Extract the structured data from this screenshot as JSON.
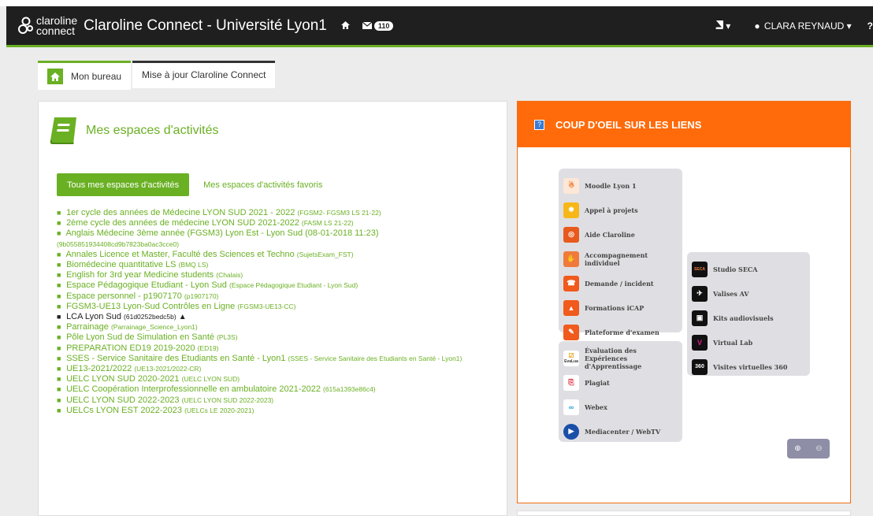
{
  "navbar": {
    "brand_line1": "claroline",
    "brand_line2": "connect",
    "title": "Claroline Connect - Université Lyon1",
    "home_icon": "home-icon",
    "mail_count": "110",
    "user_name": "CLARA REYNAUD",
    "help": "?"
  },
  "tabs": [
    {
      "label": "Mon bureau"
    },
    {
      "label": "Mise à jour Claroline Connect"
    }
  ],
  "activities": {
    "title": "Mes espaces d'activités",
    "filter_all": "Tous mes espaces d'activités",
    "filter_fav": "Mes espaces d'activités favoris",
    "items": [
      {
        "name": "1er cycle des années de Médecine LYON SUD 2021 - 2022",
        "code": "(FGSM2- FGSM3 LS 21-22)"
      },
      {
        "name": "2ème cycle des années de médecine LYON SUD 2021-2022",
        "code": "(FASM LS 21-22)"
      },
      {
        "name": "Anglais Médecine 3ème année (FGSM3) Lyon Est - Lyon Sud (08-01-2018 11:23)",
        "code": ""
      },
      {
        "name": "",
        "code": "(9b055851934408cd9b7823ba0ac3cce0)"
      },
      {
        "name": "Annales Licence et Master, Faculté des Sciences et Techno",
        "code": "(SujetsExam_FST)"
      },
      {
        "name": "Biomédecine quantitative LS",
        "code": "(BMQ LS)"
      },
      {
        "name": "English for 3rd year Medicine students",
        "code": "(Chalais)"
      },
      {
        "name": "Espace Pédagogique Etudiant - Lyon Sud",
        "code": "(Espace Pédagogique Etudiant - Lyon Sud)"
      },
      {
        "name": "Espace personnel - p1907170",
        "code": "(p1907170)"
      },
      {
        "name": "FGSM3-UE13 Lyon-Sud Contrôles en Ligne",
        "code": "(FGSM3-UE13-CC)"
      },
      {
        "name": "LCA Lyon Sud",
        "code": "(61d0252bedc5b)"
      },
      {
        "name": "Parrainage",
        "code": "(Parrainage_Science_Lyon1)"
      },
      {
        "name": "Pôle Lyon Sud de Simulation en Santé",
        "code": "(PL3S)"
      },
      {
        "name": "PREPARATION ED19 2019-2020",
        "code": "(ED19)"
      },
      {
        "name": "SSES - Service Sanitaire des Etudiants en Santé - Lyon1",
        "code": "(SSES - Service Sanitaire des Etudiants en Santé - Lyon1)"
      },
      {
        "name": "UE13-2021/2022",
        "code": "(UE13-2021/2022-CR)"
      },
      {
        "name": "UELC LYON SUD 2020-2021",
        "code": "(UELC LYON SUD)"
      },
      {
        "name": "UELC Coopération Interprofessionnelle en ambulatoire 2021-2022",
        "code": "(615a1393e86c4)"
      },
      {
        "name": "UELC LYON SUD 2022-2023",
        "code": "(UELC LYON SUD 2022-2023)"
      },
      {
        "name": "UELCs LYON EST 2022-2023",
        "code": "(UELCs LE 2020-2021)"
      }
    ]
  },
  "links": {
    "title": "COUP D'OEIL SUR LES LIENS",
    "box1": [
      "Moodle Lyon 1",
      "Appel à projets",
      "Aide Claroline",
      "Accompagnement individuel",
      "Demande / incident",
      "Formations iCAP",
      "Plateforme d'examen"
    ],
    "box2": [
      "Évaluation des Expériences d'Apprentissage",
      "Plagiat",
      "Webex",
      "Mediacenter / WebTV"
    ],
    "box3": [
      "Studio SECA",
      "Valises AV",
      "Kits audiovisuels",
      "Virtual Lab",
      "Visites virtuelles 360"
    ],
    "seca_logo": "SECA",
    "evalua_logo": "EvaLua",
    "v360_logo": "360"
  }
}
